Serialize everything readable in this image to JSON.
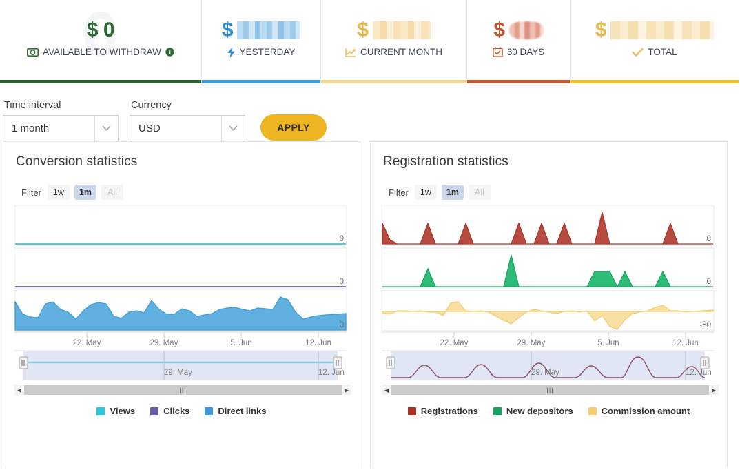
{
  "stat_cards": [
    {
      "value": "$ 0",
      "value_redacted": false,
      "label": "AVAILABLE TO WITHDRAW",
      "icon": "banknote-icon",
      "has_info_icon": true,
      "value_color": "#2d6a33",
      "underline_color": "#2d5f34",
      "watermark": "0"
    },
    {
      "value": "$",
      "value_redacted": true,
      "redact_style": "blue",
      "label": "YESTERDAY",
      "icon": "lightning-bolt-icon",
      "has_info_icon": false,
      "value_color": "#2f8fd0",
      "underline_color": "#3d9ad6",
      "watermark": ""
    },
    {
      "value": "$",
      "value_redacted": true,
      "redact_style": "lyellow",
      "label": "CURRENT MONTH",
      "icon": "line-chart-icon",
      "has_info_icon": false,
      "value_color": "#e9b84a",
      "underline_color": "#f6dc96",
      "watermark": ""
    },
    {
      "value": "$",
      "value_redacted": true,
      "redact_style": "red",
      "label": "30 DAYS",
      "icon": "calendar-check-icon",
      "has_info_icon": false,
      "value_color": "#c0562e",
      "underline_color": "#bd5730",
      "watermark": ""
    },
    {
      "value": "$",
      "value_redacted": true,
      "redact_style": "gold",
      "label": "TOTAL",
      "icon": "checkmark-icon",
      "has_info_icon": false,
      "value_color": "#e9b84a",
      "underline_color": "#eec52c",
      "watermark": ""
    }
  ],
  "controls": {
    "time_interval_label": "Time interval",
    "time_interval_value": "1 month",
    "currency_label": "Currency",
    "currency_value": "USD",
    "apply_label": "APPLY"
  },
  "panels": {
    "left": {
      "title": "Conversion statistics",
      "filter_word": "Filter",
      "filter_buttons": [
        {
          "label": "1w",
          "state": "normal"
        },
        {
          "label": "1m",
          "state": "active"
        },
        {
          "label": "All",
          "state": "disabled"
        }
      ],
      "navigator": {
        "left_date": "29. May",
        "right_date": "12. Jun"
      },
      "legend": [
        {
          "label": "Views",
          "color": "#2ec7d9"
        },
        {
          "label": "Clicks",
          "color": "#6b5aa8"
        },
        {
          "label": "Direct links",
          "color": "#3d9ad6"
        }
      ]
    },
    "right": {
      "title": "Registration statistics",
      "filter_word": "Filter",
      "filter_buttons": [
        {
          "label": "1w",
          "state": "normal"
        },
        {
          "label": "1m",
          "state": "active"
        },
        {
          "label": "All",
          "state": "disabled"
        }
      ],
      "navigator": {
        "left_date": "29. May",
        "right_date": "12. Jun"
      },
      "legend": [
        {
          "label": "Registrations",
          "color": "#a93226"
        },
        {
          "label": "New depositors",
          "color": "#1aa260"
        },
        {
          "label": "Commission amount",
          "color": "#f5cd72"
        }
      ]
    }
  },
  "chart_data": [
    {
      "type": "area",
      "title": "Conversion statistics",
      "xlabel": "",
      "ylabel": "",
      "grid": false,
      "legend_position": "bottom",
      "x_tick_labels": [
        "22. May",
        "29. May",
        "5. Jun",
        "12. Jun"
      ],
      "panes": [
        {
          "name": "Views",
          "color": "#2ec7d9",
          "ylim": [
            0,
            1
          ],
          "y_tick_labels": [
            "0"
          ],
          "values": [
            0,
            0,
            0,
            0,
            0,
            0,
            0,
            0,
            0,
            0,
            0,
            0,
            0,
            0,
            0,
            0,
            0,
            0,
            0,
            0,
            0,
            0,
            0,
            0,
            0,
            0,
            0,
            0,
            0,
            0,
            0
          ]
        },
        {
          "name": "Clicks",
          "color": "#6b5aa8",
          "ylim": [
            0,
            1
          ],
          "y_tick_labels": [
            "0"
          ],
          "values": [
            0,
            0,
            0,
            0,
            0,
            0,
            0,
            0,
            0,
            0,
            0,
            0,
            0,
            0,
            0,
            0,
            0,
            0,
            0,
            0,
            0,
            0,
            0,
            0,
            0,
            0,
            0,
            0,
            0,
            0,
            0
          ]
        },
        {
          "name": "Direct links",
          "color": "#3d9ad6",
          "ylim": [
            0,
            100
          ],
          "y_tick_labels": [
            "0"
          ],
          "values": [
            72,
            40,
            32,
            30,
            66,
            72,
            50,
            44,
            26,
            48,
            64,
            70,
            66,
            34,
            28,
            44,
            48,
            42,
            76,
            50,
            38,
            38,
            52,
            46,
            34,
            38,
            42,
            52,
            56,
            58,
            52,
            48,
            56,
            54,
            52,
            86,
            78,
            44,
            26,
            34,
            38,
            40,
            44
          ]
        }
      ],
      "navigator_series": {
        "name": "Views",
        "color": "#7ec8e8",
        "values": [
          0,
          0,
          0,
          0,
          0,
          0,
          0,
          0,
          0,
          0,
          0,
          0,
          0,
          0,
          0,
          0,
          0,
          0,
          0,
          0
        ]
      }
    },
    {
      "type": "area",
      "title": "Registration statistics",
      "xlabel": "",
      "ylabel": "",
      "grid": false,
      "legend_position": "bottom",
      "x_tick_labels": [
        "22. May",
        "29. May",
        "5. Jun",
        "12. Jun"
      ],
      "panes": [
        {
          "name": "Registrations",
          "color": "#a93226",
          "ylim": [
            0,
            4
          ],
          "y_tick_labels": [
            "0"
          ],
          "values": [
            2,
            1,
            0,
            0,
            0,
            0,
            2,
            0,
            0,
            0,
            0,
            2,
            0,
            0,
            0,
            0,
            0,
            0,
            2,
            0,
            0,
            2,
            0,
            0,
            2,
            0,
            0,
            0,
            3,
            0,
            0,
            0,
            0,
            0,
            0,
            0,
            2,
            0,
            0
          ]
        },
        {
          "name": "New depositors",
          "color": "#1aa260",
          "ylim": [
            0,
            3
          ],
          "y_tick_labels": [
            "0"
          ],
          "values": [
            0,
            0,
            0,
            0,
            0,
            1,
            0,
            0,
            0,
            0,
            0,
            0,
            0,
            0,
            0,
            2,
            0,
            0,
            0,
            0,
            0,
            0,
            0,
            0,
            0,
            1.4,
            1.4,
            0,
            1,
            0,
            0,
            1,
            0,
            0,
            0,
            0,
            0,
            0,
            0
          ]
        },
        {
          "name": "Commission amount",
          "color": "#f5cd72",
          "ylim": [
            -80,
            20
          ],
          "y_tick_labels": [
            "-80"
          ],
          "values": [
            -5,
            -8,
            -2,
            -2,
            -3,
            -2,
            -4,
            -4,
            -10,
            12,
            14,
            -2,
            -3,
            -2,
            -4,
            -12,
            -22,
            -32,
            -16,
            -4,
            2,
            -2,
            -4,
            -6,
            -3,
            -2,
            -4,
            -2,
            -26,
            -12,
            -40,
            -56,
            -22,
            -6,
            -4,
            -2,
            6,
            10,
            -2,
            -2,
            -4,
            -3
          ]
        }
      ],
      "navigator_series": {
        "name": "Registrations",
        "color": "#8e4b5e",
        "values": [
          0,
          0,
          1,
          0,
          0,
          1,
          0,
          0,
          0,
          1,
          0,
          0,
          0,
          1,
          0,
          0,
          1,
          0,
          0,
          2,
          0,
          0,
          1,
          0
        ]
      }
    }
  ]
}
